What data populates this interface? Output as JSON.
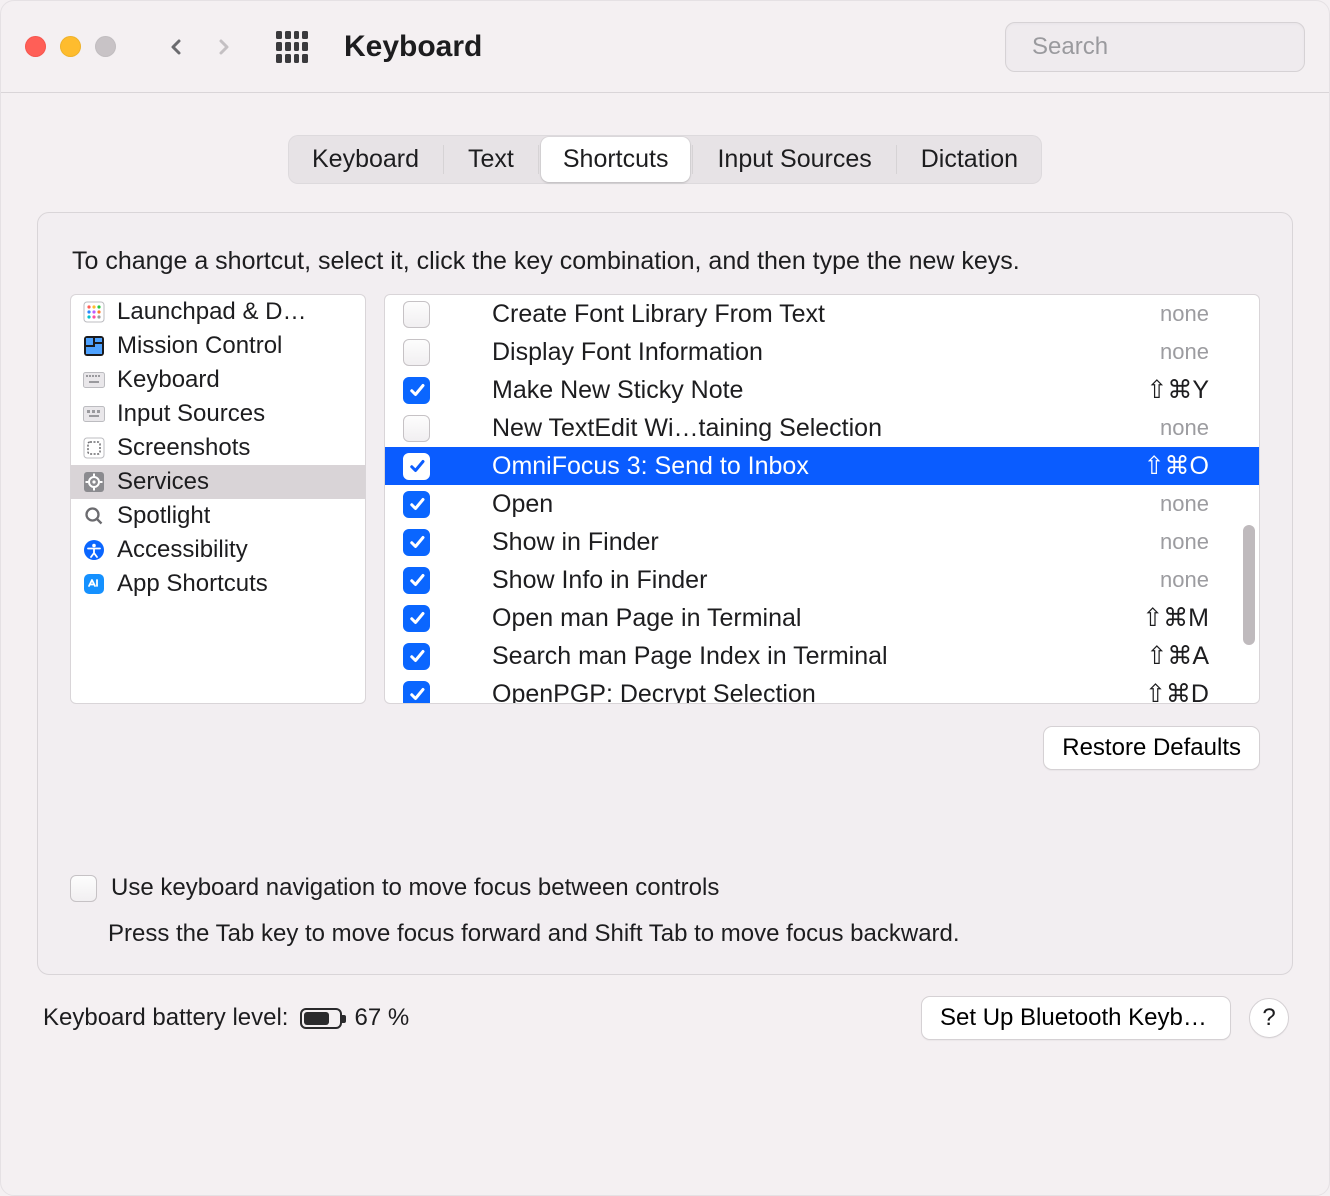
{
  "window": {
    "title": "Keyboard",
    "search_placeholder": "Search"
  },
  "tabs": {
    "items": [
      "Keyboard",
      "Text",
      "Shortcuts",
      "Input Sources",
      "Dictation"
    ],
    "active_index": 2
  },
  "instruction": "To change a shortcut, select it, click the key combination, and then type the new keys.",
  "categories": {
    "selected_index": 5,
    "items": [
      {
        "icon": "launchpad-icon",
        "label": "Launchpad & D…"
      },
      {
        "icon": "mission-control-icon",
        "label": "Mission Control"
      },
      {
        "icon": "keyboard-icon",
        "label": "Keyboard"
      },
      {
        "icon": "input-sources-icon",
        "label": "Input Sources"
      },
      {
        "icon": "screenshots-icon",
        "label": "Screenshots"
      },
      {
        "icon": "services-icon",
        "label": "Services"
      },
      {
        "icon": "spotlight-icon",
        "label": "Spotlight"
      },
      {
        "icon": "accessibility-icon",
        "label": "Accessibility"
      },
      {
        "icon": "app-shortcuts-icon",
        "label": "App Shortcuts"
      }
    ]
  },
  "shortcuts": {
    "selected_index": 4,
    "rows": [
      {
        "enabled": false,
        "label": "Create Font Library From Text",
        "keys": "none"
      },
      {
        "enabled": false,
        "label": "Display Font Information",
        "keys": "none"
      },
      {
        "enabled": true,
        "label": "Make New Sticky Note",
        "keys": "⇧⌘Y"
      },
      {
        "enabled": false,
        "label": "New TextEdit Wi…taining Selection",
        "keys": "none"
      },
      {
        "enabled": true,
        "label": "OmniFocus 3: Send to Inbox",
        "keys": "⇧⌘O"
      },
      {
        "enabled": true,
        "label": "Open",
        "keys": "none"
      },
      {
        "enabled": true,
        "label": "Show in Finder",
        "keys": "none"
      },
      {
        "enabled": true,
        "label": "Show Info in Finder",
        "keys": "none"
      },
      {
        "enabled": true,
        "label": "Open man Page in Terminal",
        "keys": "⇧⌘M"
      },
      {
        "enabled": true,
        "label": "Search man Page Index in Terminal",
        "keys": "⇧⌘A"
      },
      {
        "enabled": true,
        "label": "OpenPGP: Decrypt Selection",
        "keys": "⇧⌘D"
      }
    ]
  },
  "buttons": {
    "restore_defaults": "Restore Defaults",
    "bluetooth_keyboard": "Set Up Bluetooth Keyboard…",
    "help": "?"
  },
  "keyboard_nav": {
    "checkbox_label": "Use keyboard navigation to move focus between controls",
    "hint": "Press the Tab key to move focus forward and Shift Tab to move focus backward."
  },
  "footer": {
    "battery_label": "Keyboard battery level:",
    "battery_pct": "67 %"
  }
}
